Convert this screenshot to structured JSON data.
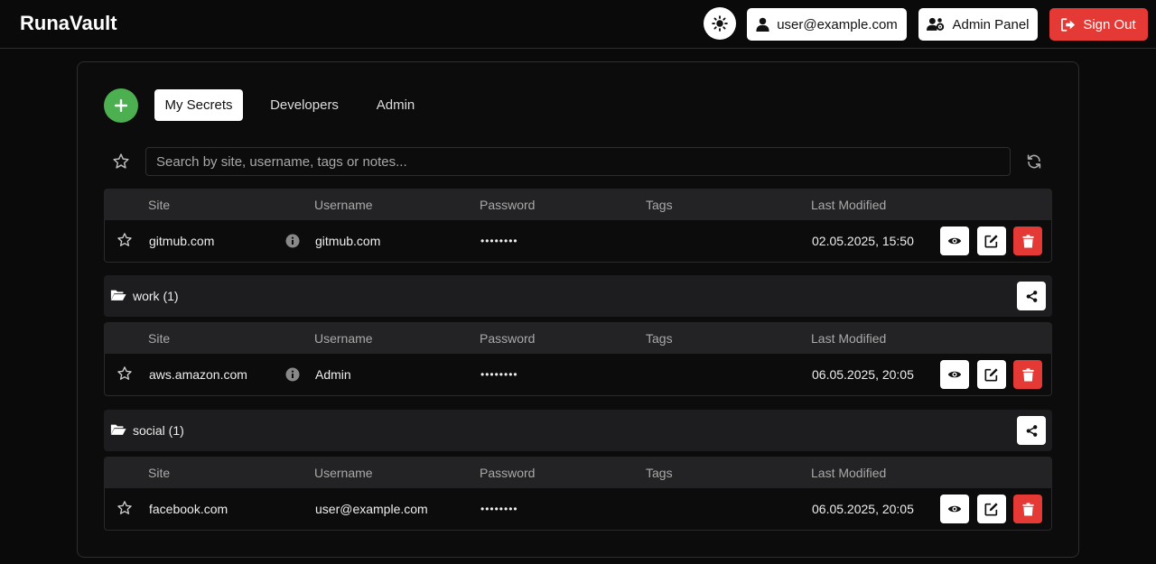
{
  "header": {
    "brand": "RunaVault",
    "user_label": "user@example.com",
    "admin_label": "Admin Panel",
    "signout_label": "Sign Out"
  },
  "tabs": [
    {
      "label": "My Secrets",
      "active": true
    },
    {
      "label": "Developers",
      "active": false
    },
    {
      "label": "Admin",
      "active": false
    }
  ],
  "search": {
    "placeholder": "Search by site, username, tags or notes...",
    "value": ""
  },
  "columns": {
    "site": "Site",
    "username": "Username",
    "password": "Password",
    "tags": "Tags",
    "modified": "Last Modified"
  },
  "ungrouped": [
    {
      "site": "gitmub.com",
      "username": "gitmub.com",
      "password": "••••••••",
      "tags": "",
      "modified": "02.05.2025, 15:50",
      "has_info": true
    }
  ],
  "groups": [
    {
      "name": "work (1)",
      "rows": [
        {
          "site": "aws.amazon.com",
          "username": "Admin",
          "password": "••••••••",
          "tags": "",
          "modified": "06.05.2025, 20:05",
          "has_info": true
        }
      ]
    },
    {
      "name": "social (1)",
      "rows": [
        {
          "site": "facebook.com",
          "username": "user@example.com",
          "password": "••••••••",
          "tags": "",
          "modified": "06.05.2025, 20:05",
          "has_info": false
        }
      ]
    }
  ],
  "colors": {
    "accent_green": "#4caf50",
    "danger_red": "#e53935",
    "background": "#0a0a0b"
  }
}
